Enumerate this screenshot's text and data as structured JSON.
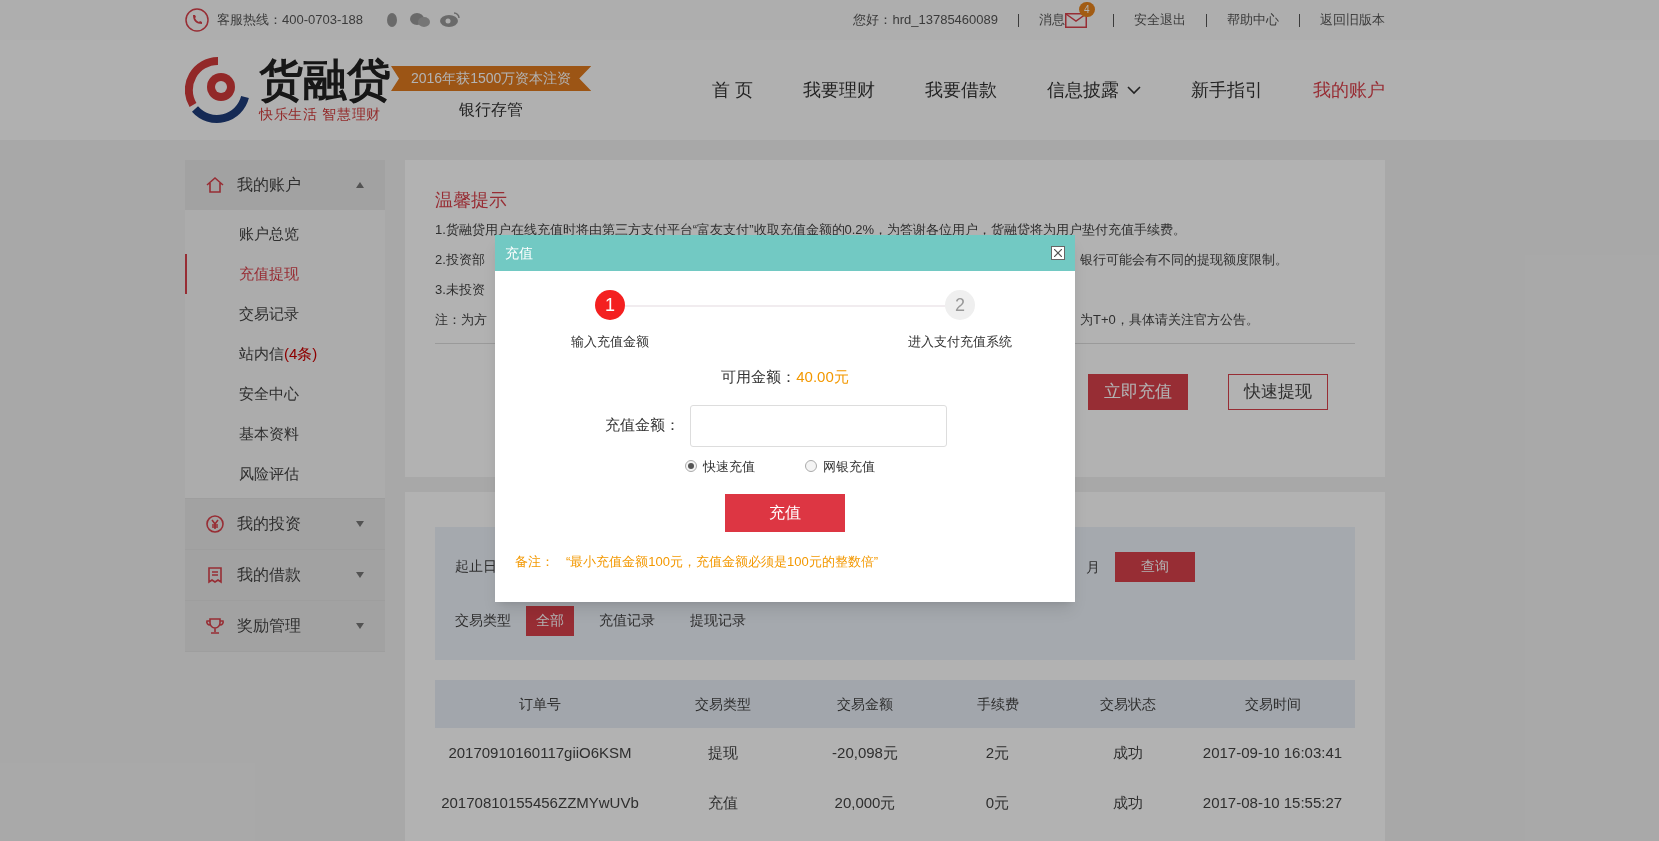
{
  "top_bar": {
    "hotline": "客服热线：400-0703-188",
    "greeting": "您好：hrd_13785460089",
    "messages": {
      "label": "消息",
      "count": "4"
    },
    "links": [
      "安全退出",
      "帮助中心",
      "返回旧版本"
    ]
  },
  "header": {
    "logo_text": "货融贷",
    "slogan": "快乐生活 智慧理财",
    "ribbon": "2016年获1500万资本注资",
    "bank_note": "银行存管",
    "nav": [
      {
        "label": "首 页",
        "selected": false,
        "dropdown": false
      },
      {
        "label": "我要理财",
        "selected": false,
        "dropdown": false
      },
      {
        "label": "我要借款",
        "selected": false,
        "dropdown": false
      },
      {
        "label": "信息披露",
        "selected": false,
        "dropdown": true
      },
      {
        "label": "新手指引",
        "selected": false,
        "dropdown": false
      },
      {
        "label": "我的账户",
        "selected": true,
        "dropdown": false
      }
    ]
  },
  "sidebar": [
    {
      "title": "我的账户",
      "expanded": true,
      "items": [
        {
          "label": "账户总览",
          "selected": false
        },
        {
          "label": "充值提现",
          "selected": true
        },
        {
          "label": "交易记录",
          "selected": false
        },
        {
          "label": "站内信",
          "badge": "(4条)",
          "selected": false
        },
        {
          "label": "安全中心",
          "selected": false
        },
        {
          "label": "基本资料",
          "selected": false
        },
        {
          "label": "风险评估",
          "selected": false
        }
      ]
    },
    {
      "title": "我的投资",
      "expanded": false
    },
    {
      "title": "我的借款",
      "expanded": false
    },
    {
      "title": "奖励管理",
      "expanded": false
    }
  ],
  "tips": {
    "title": "温馨提示",
    "lines": [
      {
        "left": "1.货融贷用户在线充值时将由第三方支付平台“富友支付”收取充值金额的0.2%，为答谢各位用户，货融贷将为用户垫付充值手续费。"
      },
      {
        "left": "2.投资部",
        "right": "银行可能会有不同的提现额度限制。"
      },
      {
        "left": "3.未投资"
      },
      {
        "left": "注：为方",
        "right": "为T+0，具体请关注官方公告。"
      }
    ],
    "buttons": [
      {
        "label": "立即充值",
        "kind": "primary"
      },
      {
        "label": "快速提现",
        "kind": "outline"
      }
    ]
  },
  "records": {
    "query": {
      "label": "起止日",
      "suffix": "月",
      "button": "查询"
    },
    "type_filter": {
      "label": "交易类型",
      "options": [
        {
          "label": "全部",
          "selected": true
        },
        {
          "label": "充值记录",
          "selected": false
        },
        {
          "label": "提现记录",
          "selected": false
        }
      ]
    },
    "table": {
      "columns": [
        "订单号",
        "交易类型",
        "交易金额",
        "手续费",
        "交易状态",
        "交易时间"
      ],
      "rows": [
        [
          "20170910160117giiO6KSM",
          "提现",
          "-20,098元",
          "2元",
          "成功",
          "2017-09-10 16:03:41"
        ],
        [
          "20170810155456ZZMYwUVb",
          "充值",
          "20,000元",
          "0元",
          "成功",
          "2017-08-10 15:55:27"
        ]
      ]
    }
  },
  "modal": {
    "title": "充值",
    "steps": [
      {
        "number": "1",
        "label": "输入充值金额",
        "selected": true
      },
      {
        "number": "2",
        "label": "进入支付充值系统",
        "selected": false
      }
    ],
    "balance": {
      "label": "可用金额：",
      "value": "40.00元"
    },
    "amount_field": {
      "label": "充值金额："
    },
    "methods": [
      {
        "label": "快速充值",
        "selected": true
      },
      {
        "label": "网银充值",
        "selected": false
      }
    ],
    "submit": "充值",
    "note_label": "备注：",
    "note_text": "“最小充值金额100元，充值金额必须是100元的整数倍”"
  }
}
